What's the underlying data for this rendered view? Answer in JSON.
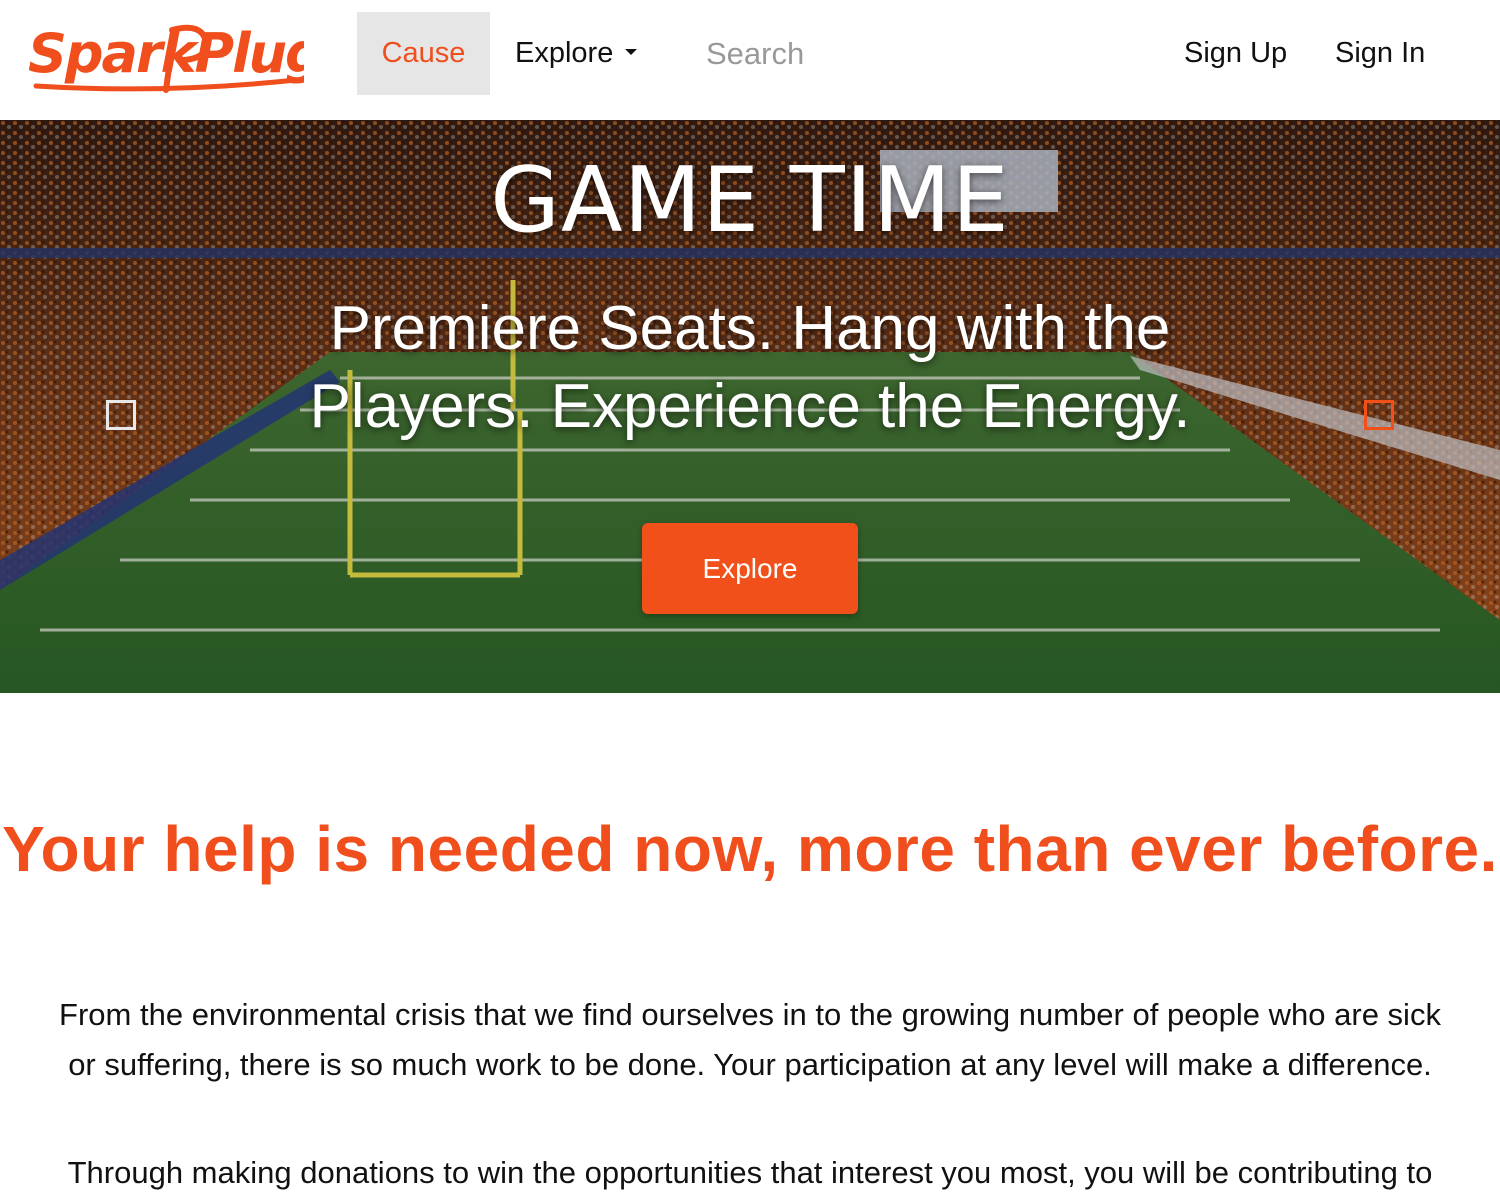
{
  "brand": {
    "name": "SparkPlugg",
    "color": "#f04e1c"
  },
  "nav": {
    "cause_label": "Cause",
    "explore_label": "Explore",
    "search_placeholder": "Search",
    "signup_label": "Sign Up",
    "signin_label": "Sign In"
  },
  "hero": {
    "title": "GAME TIME",
    "subtitle": "Premiere Seats. Hang with the Players. Experience the Energy.",
    "button_label": "Explore",
    "accent": "#f2501a"
  },
  "content": {
    "headline": "Your help is needed now, more than ever before.",
    "paragraph_1": "From the environmental crisis that we find ourselves in to the growing number of people who are sick or suffering, there is so much work to be done. Your participation at any level will make a difference.",
    "paragraph_2": "Through making donations to win the opportunities that interest you most, you will be contributing to"
  }
}
